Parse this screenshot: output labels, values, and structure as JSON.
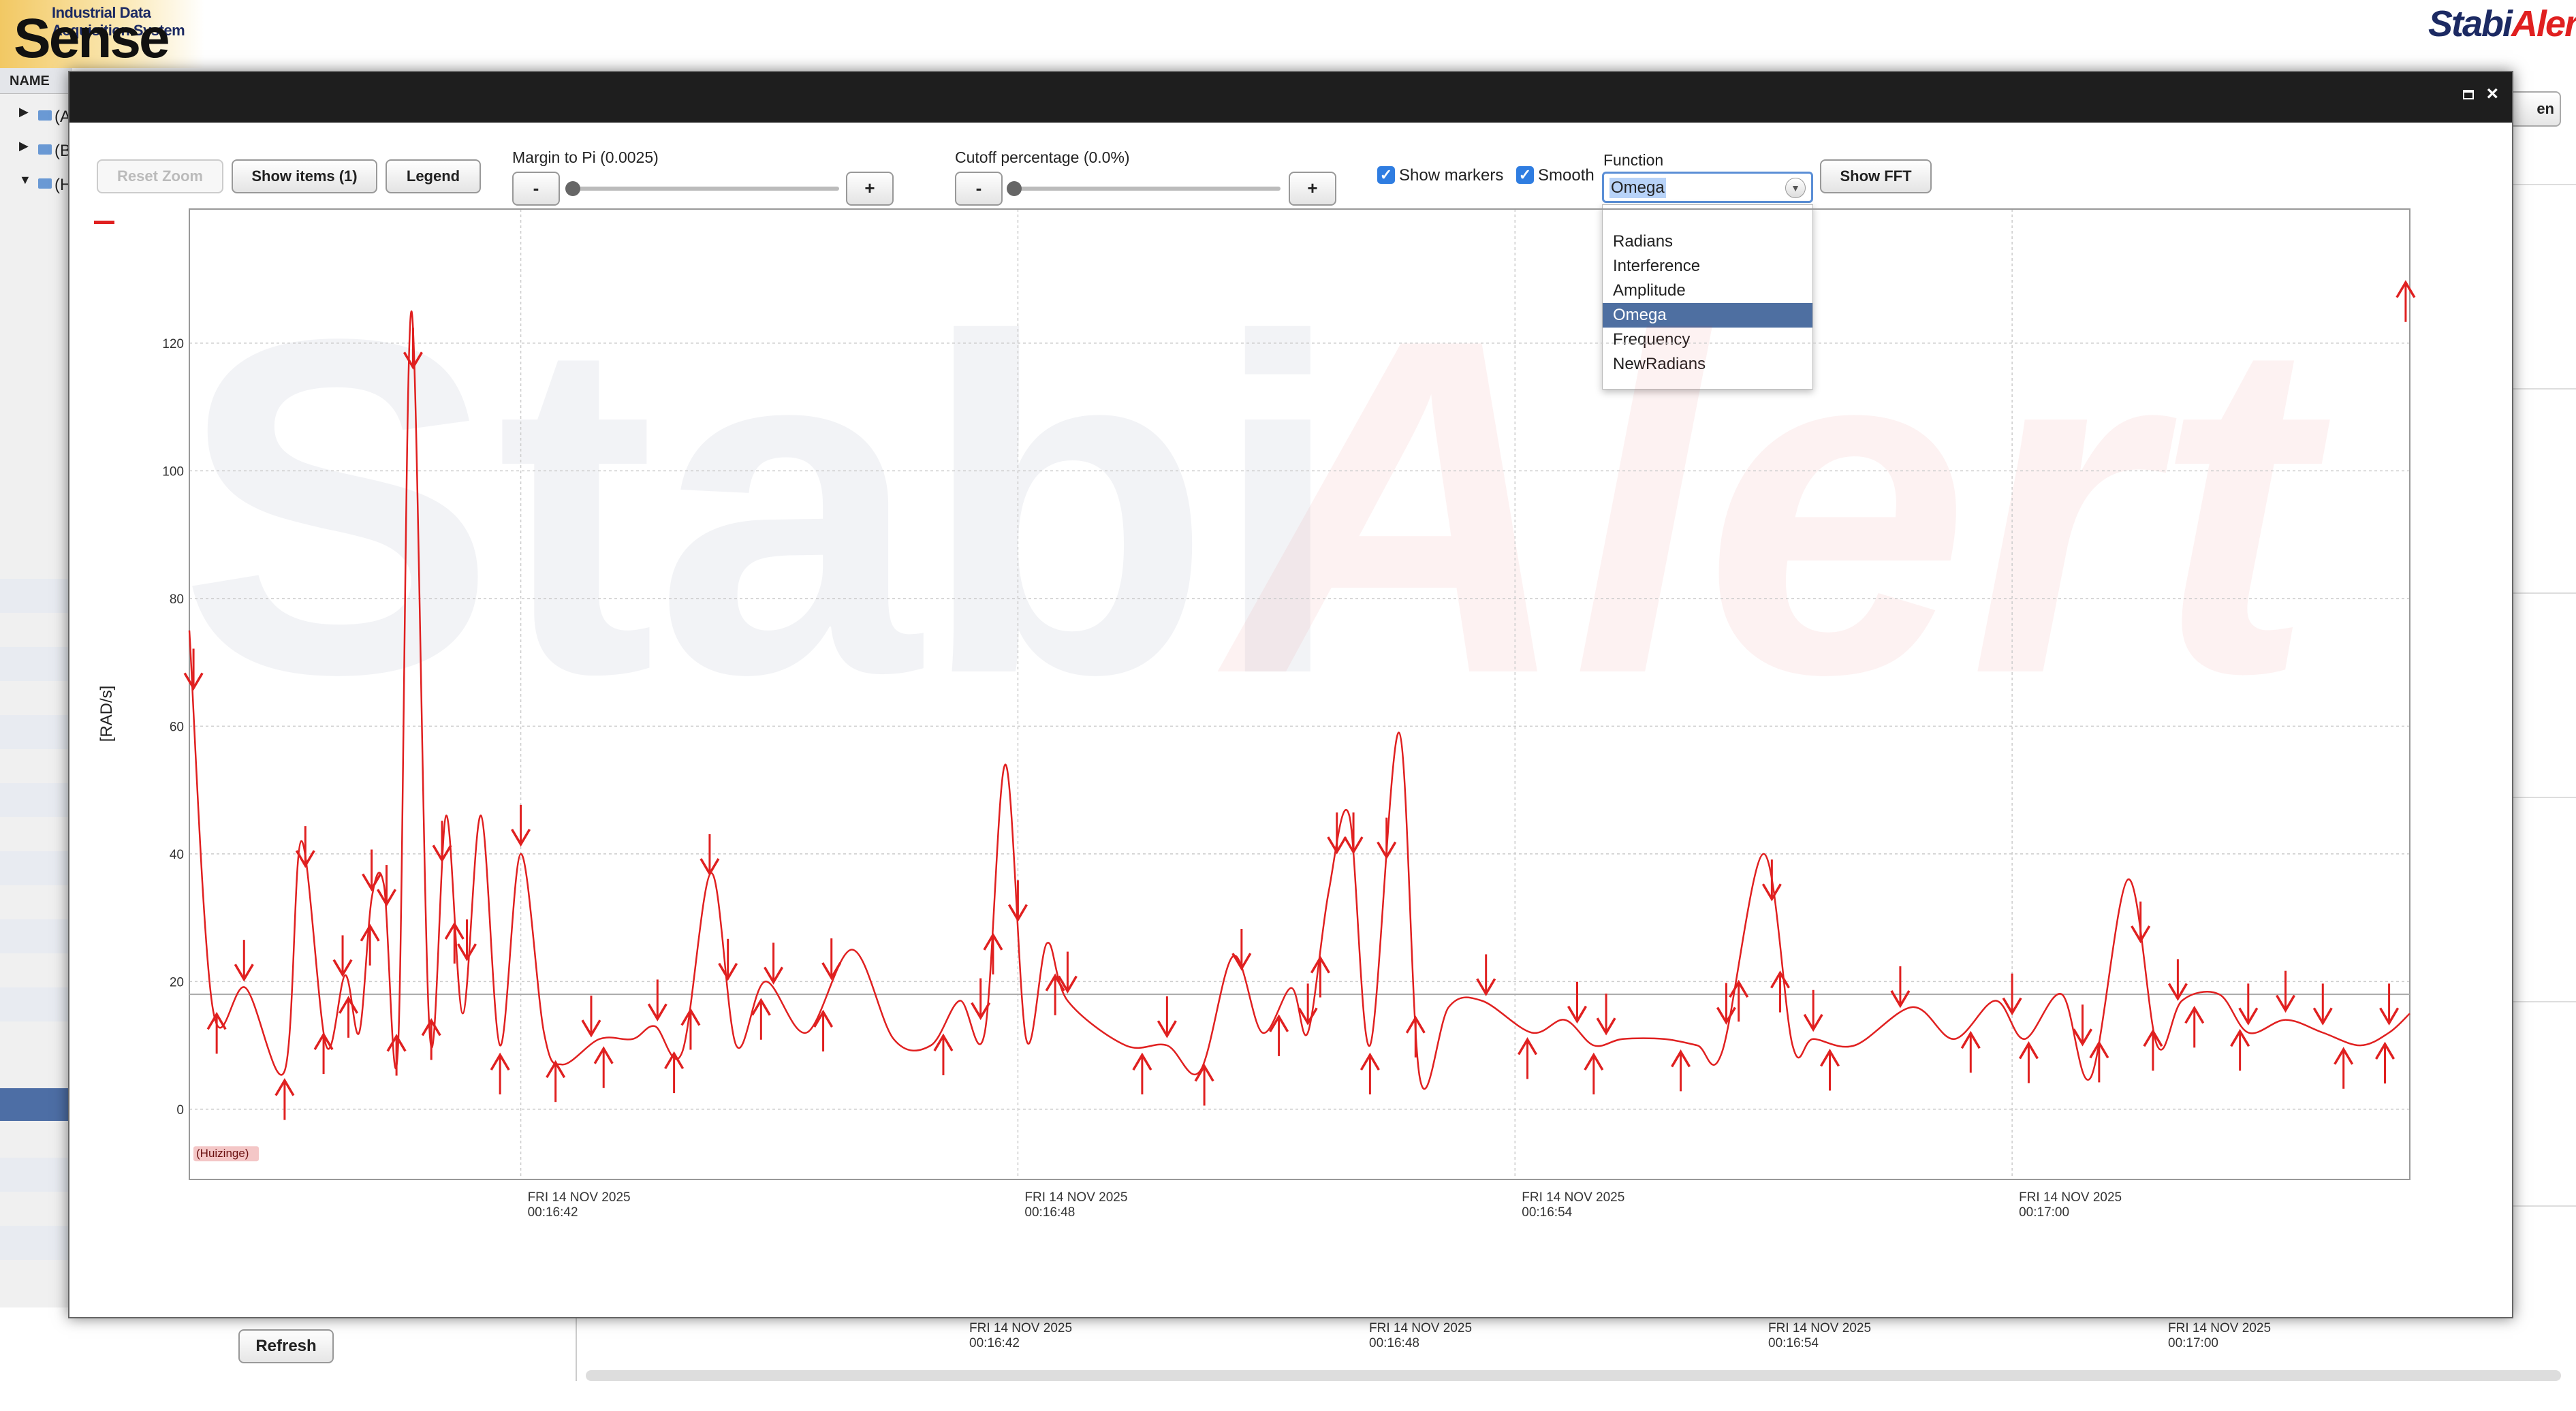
{
  "app": {
    "subtitle": "Industrial Data Acquisition System",
    "title": "Sense",
    "brand_left": "Stabi",
    "brand_right": "Alert"
  },
  "sidebar": {
    "header": "NAME",
    "items": [
      {
        "label": "(A",
        "expanded": false
      },
      {
        "label": "(B",
        "expanded": false
      },
      {
        "label": "(H",
        "expanded": true
      }
    ]
  },
  "background": {
    "refresh_label": "Refresh",
    "open_label": "en",
    "time_ticks": [
      {
        "day": "FRI 14 NOV 2025",
        "time": "00:16:42"
      },
      {
        "day": "FRI 14 NOV 2025",
        "time": "00:16:48"
      },
      {
        "day": "FRI 14 NOV 2025",
        "time": "00:16:54"
      },
      {
        "day": "FRI 14 NOV 2025",
        "time": "00:17:00"
      }
    ]
  },
  "toolbar": {
    "reset_zoom": "Reset Zoom",
    "show_items": "Show items (1)",
    "legend": "Legend",
    "margin_label": "Margin to Pi (0.0025)",
    "margin_value": 0.0025,
    "cutoff_label": "Cutoff percentage (0.0%)",
    "cutoff_value": 0,
    "minus": "-",
    "plus": "+",
    "show_markers_label": "Show markers",
    "show_markers_checked": true,
    "smooth_label": "Smooth",
    "smooth_checked": true,
    "function_label": "Function",
    "function_value": "Omega",
    "function_options": [
      "",
      "Radians",
      "Interference",
      "Amplitude",
      "Omega",
      "Frequency",
      "NewRadians"
    ],
    "show_fft": "Show FFT"
  },
  "colors": {
    "series": "#e02020",
    "watermark_blue": "#1c2a63",
    "watermark_red": "#e02020"
  },
  "watermark": {
    "left": "Stabi",
    "right": "Alert"
  },
  "chart_data": {
    "type": "line",
    "title": "",
    "xlabel": "",
    "ylabel": "[RAD/s]",
    "ylim": [
      -11,
      141
    ],
    "xlim": [
      0,
      26.8
    ],
    "y_ticks": [
      0,
      20,
      40,
      60,
      80,
      100,
      120
    ],
    "x_ticks": [
      {
        "value": 4,
        "day": "FRI 14 NOV 2025",
        "time": "00:16:42"
      },
      {
        "value": 10,
        "day": "FRI 14 NOV 2025",
        "time": "00:16:48"
      },
      {
        "value": 16,
        "day": "FRI 14 NOV 2025",
        "time": "00:16:54"
      },
      {
        "value": 22,
        "day": "FRI 14 NOV 2025",
        "time": "00:17:00"
      }
    ],
    "grid": true,
    "reference_line": 18,
    "series_label": "(Huizinge)",
    "series": [
      {
        "name": "",
        "x": [
          0,
          0.28,
          0.68,
          1.15,
          1.35,
          1.65,
          1.88,
          2.05,
          2.2,
          2.35,
          2.52,
          2.68,
          2.9,
          3.1,
          3.3,
          3.52,
          3.75,
          4,
          4.28,
          4.5,
          4.95,
          5.35,
          5.62,
          5.95,
          6.3,
          6.6,
          6.95,
          7.45,
          8.0,
          8.5,
          8.95,
          9.3,
          9.6,
          9.85,
          10.1,
          10.35,
          10.6,
          11.3,
          11.8,
          12.2,
          12.6,
          12.95,
          13.3,
          13.5,
          13.75,
          14.0,
          14.25,
          14.6,
          14.85,
          15.2,
          15.6,
          16.2,
          16.6,
          16.95,
          17.3,
          17.8,
          18.2,
          18.5,
          19.0,
          19.35,
          19.6,
          20.1,
          20.8,
          21.3,
          21.8,
          22.15,
          22.6,
          22.95,
          23.4,
          23.75,
          24.05,
          24.5,
          24.85,
          25.3,
          25.75,
          26.2,
          26.55,
          26.8
        ],
        "values": [
          75,
          16,
          19,
          6,
          42,
          10,
          21,
          12,
          33,
          35,
          10,
          125,
          12,
          46,
          15,
          46,
          10,
          40,
          12,
          7,
          11,
          11,
          13,
          9,
          37,
          10,
          20,
          12,
          25,
          11,
          10,
          17,
          12,
          54,
          11,
          26,
          17,
          10,
          10,
          6,
          24,
          12,
          19,
          12,
          34,
          46,
          10,
          59,
          5,
          16,
          17,
          12,
          14,
          10,
          11,
          11,
          10,
          9,
          40,
          10,
          11,
          10,
          16,
          11,
          17,
          11,
          18,
          5,
          36,
          10,
          17,
          18,
          12,
          14,
          12,
          10,
          12,
          15
        ]
      }
    ],
    "markers_up": [
      0.33,
      1.15,
      1.62,
      1.92,
      2.18,
      2.5,
      2.92,
      3.2,
      3.75,
      4.42,
      5.0,
      5.85,
      6.05,
      6.9,
      7.65,
      9.1,
      9.7,
      10.45,
      11.5,
      12.25,
      13.15,
      13.65,
      14.25,
      14.8,
      16.15,
      16.95,
      18.0,
      18.7,
      19.2,
      19.8,
      21.5,
      22.2,
      23.05,
      23.7,
      24.2,
      24.75,
      26.0,
      26.5
    ],
    "markers_down": [
      0.66,
      1.4,
      1.85,
      2.2,
      2.38,
      2.7,
      3.05,
      3.35,
      4.0,
      4.85,
      5.65,
      6.28,
      6.5,
      7.05,
      7.75,
      9.55,
      10.0,
      10.6,
      11.8,
      12.7,
      13.5,
      13.85,
      14.05,
      14.45,
      15.65,
      16.75,
      17.1,
      18.55,
      19.1,
      19.6,
      20.65,
      22.0,
      22.85,
      23.55,
      24.0,
      24.85,
      25.3,
      25.75,
      26.55
    ],
    "markers_edge_up": [
      26.75
    ],
    "markers_edge_down": [
      0.05
    ]
  }
}
